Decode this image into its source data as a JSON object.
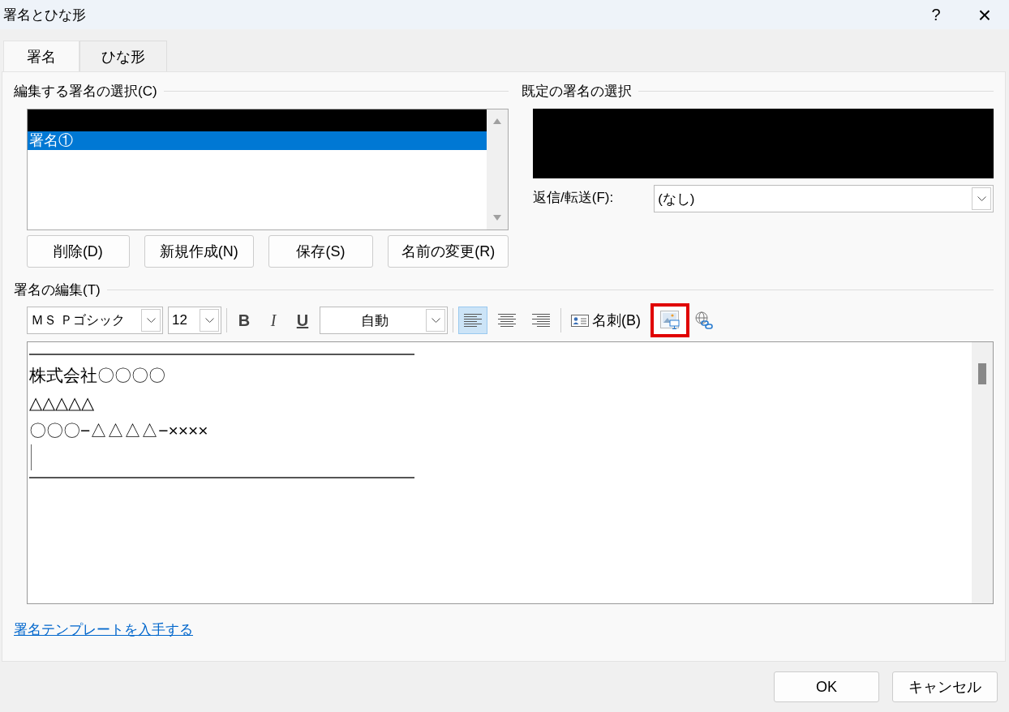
{
  "window": {
    "title": "署名とひな形",
    "help": "?",
    "close": "×"
  },
  "tabs": [
    {
      "label": "署名",
      "selected": true
    },
    {
      "label": "ひな形",
      "selected": false
    }
  ],
  "edit_select": {
    "heading": "編集する署名の選択(C)",
    "items": [
      {
        "label": "署名①",
        "selected": true
      }
    ],
    "buttons": [
      "削除(D)",
      "新規作成(N)",
      "保存(S)",
      "名前の変更(R)"
    ]
  },
  "default_select": {
    "heading": "既定の署名の選択",
    "reply_label": "返信/転送(F):",
    "reply_value": "(なし)"
  },
  "editor": {
    "heading": "署名の編集(T)",
    "font": "ＭＳ Ｐゴシック",
    "size": "12",
    "format_buttons": [
      {
        "label": "B",
        "kind": "bold"
      },
      {
        "label": "I",
        "kind": "italic"
      },
      {
        "label": "U",
        "kind": "underline"
      }
    ],
    "font_color_label": "自動",
    "align_buttons": [
      {
        "kind": "left",
        "selected": true
      },
      {
        "kind": "center",
        "selected": false
      },
      {
        "kind": "right",
        "selected": false
      }
    ],
    "card_button": "名刺(B)",
    "picture_button": {
      "highlighted": true
    },
    "lines": [
      {
        "kind": "rule"
      },
      {
        "kind": "text",
        "text": "株式会社〇〇〇〇"
      },
      {
        "kind": "text",
        "text": "△△△△△"
      },
      {
        "kind": "text",
        "text": "〇〇〇−△△△△−××××"
      },
      {
        "kind": "cursor"
      },
      {
        "kind": "rule"
      }
    ]
  },
  "template_link": "署名テンプレートを入手する",
  "buttons": [
    "OK",
    "キャンセル"
  ]
}
